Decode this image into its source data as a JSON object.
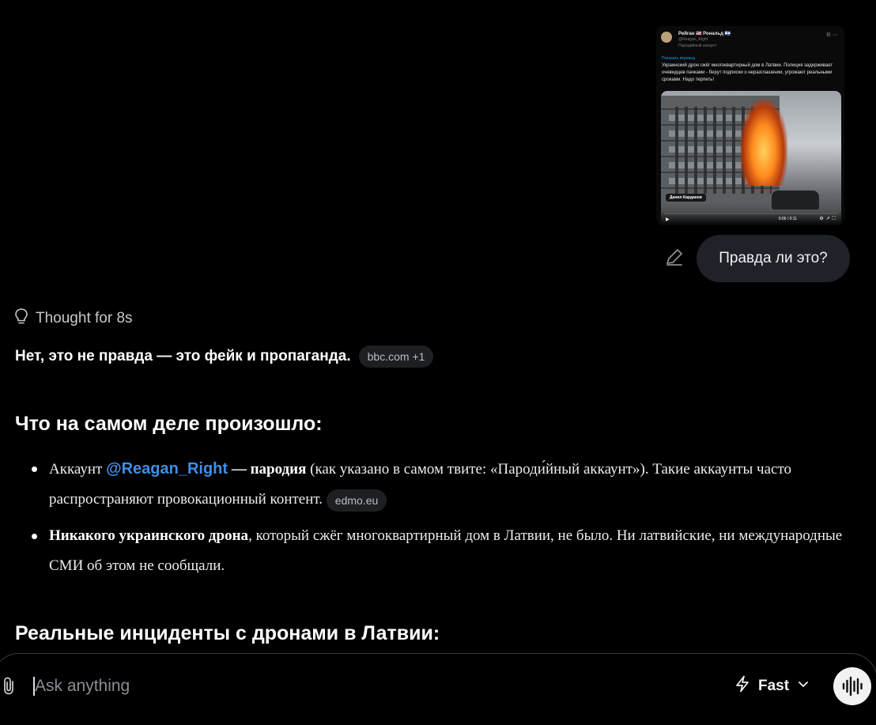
{
  "tweet": {
    "author": "Рейган 🇺🇸 Рональд 🇮🇱",
    "handle": "@Reagan_Right",
    "badge": "Пародийный аккаунт",
    "translate": "Показать перевод",
    "text": "Украинский дрон сжёг многоквартирный дом в Латвии. Полиция задерживает очевидцев пачками - берут подписки о неразглашении, угрожают реальными сроками. Надо терпеть!",
    "video_tag": "Данил Карданов",
    "video_time": "0:06 / 0:11"
  },
  "user_message": "Правда ли это?",
  "assistant": {
    "thought_label": "Thought for 8s",
    "lead": "Нет, это не правда — это фейк и пропаганда.",
    "lead_sources": "bbc.com +1",
    "section1_title": "Что на самом деле произошло:",
    "bullet1": {
      "prefix": "Аккаунт ",
      "mention": "@Reagan_Right",
      "bold": " — пародия",
      "rest": " (как указано в самом твите: «Пароди́йный аккаунт»). Такие аккаунты часто распространяют провокационный контент. ",
      "source": "edmo.eu"
    },
    "bullet2": {
      "bold": "Никакого украинского дрона",
      "rest": ", который сжёг многоквартирный дом в Латвии, не было. Ни латвийские, ни международные СМИ об этом не сообщали."
    },
    "section2_title": "Реальные инциденты с дронами в Латвии:"
  },
  "composer": {
    "placeholder": "Ask anything",
    "mode": "Fast"
  },
  "icons": {
    "edit": "pencil-icon",
    "thought": "lightbulb-icon",
    "attach": "paperclip-icon",
    "mode": "lightning-icon",
    "chevron": "chevron-down-icon",
    "voice": "waveform-icon"
  }
}
